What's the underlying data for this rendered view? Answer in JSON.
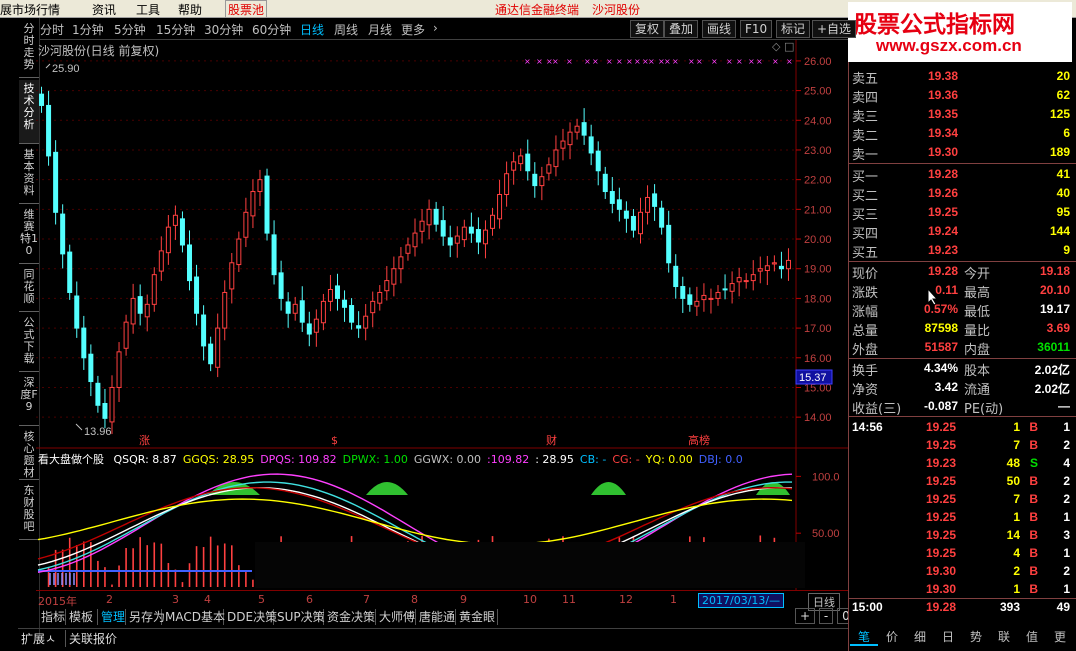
{
  "menu": {
    "items": [
      "展市场行情",
      "资讯",
      "工具",
      "帮助",
      "股票池"
    ],
    "center_text": "通达信金融终端",
    "stock_name": "沙河股份"
  },
  "watermark": {
    "title": "股票公式指标网",
    "url": "www.gszx.com.cn"
  },
  "left_nav": [
    "分时走势",
    "技术分析",
    "基本资料",
    "维赛特10",
    "同花顺",
    "公式下载",
    "深度F9",
    "核心题材",
    "东财股吧"
  ],
  "periods": [
    "分时",
    "1分钟",
    "5分钟",
    "15分钟",
    "30分钟",
    "60分钟",
    "日线",
    "周线",
    "月线",
    "更多"
  ],
  "active_period": "日线",
  "right_buttons": [
    "复权",
    "叠加",
    "画线",
    "F10",
    "标记",
    "+自选"
  ],
  "chart_title": "沙河股份(日线 前复权)",
  "price_chart": {
    "high_label": "25.90",
    "low_label": "13.96",
    "current_price_tag": "15.37",
    "y_ticks": [
      "26.00",
      "25.00",
      "24.00",
      "23.00",
      "22.00",
      "21.00",
      "20.00",
      "19.00",
      "18.00",
      "17.00",
      "16.00",
      "15.00",
      "14.00"
    ],
    "markers": [
      "涨",
      "$",
      "财",
      "高榜"
    ]
  },
  "indicator_bar": {
    "name": "看大盘做个股",
    "items": [
      {
        "label": "QSQR: 8.87",
        "color": "#ffffff"
      },
      {
        "label": "GGQS: 28.95",
        "color": "#ffff00"
      },
      {
        "label": "DPQS: 109.82",
        "color": "#ff40ff"
      },
      {
        "label": "DPWX: 1.00",
        "color": "#00e000"
      },
      {
        "label": "GGWX: 0.00",
        "color": "#c0c0c0"
      },
      {
        "label": ":109.82",
        "color": "#ff40ff"
      },
      {
        "label": ": 28.95",
        "color": "#ffffff"
      },
      {
        "label": "CB: -",
        "color": "#00bfff"
      },
      {
        "label": "CG: -",
        "color": "#ff4040"
      },
      {
        "label": "YQ: 0.00",
        "color": "#ffff00"
      },
      {
        "label": "DBJ: 0.0",
        "color": "#4060ff"
      }
    ],
    "y_ticks": [
      "100.0",
      "50.00"
    ]
  },
  "time_axis": {
    "labels": [
      "2015年",
      "2",
      "3",
      "4",
      "5",
      "6",
      "7",
      "8",
      "9",
      "10",
      "11",
      "12",
      "1"
    ],
    "cursor_date": "2017/03/13/—",
    "period": "日线"
  },
  "bottom_tabs": [
    "指标",
    "模板",
    "管理",
    "另存为",
    "MACD基本",
    "DDE决策",
    "SUP决策",
    "资金决策",
    "大师傅",
    "唐能通",
    "黄金眼"
  ],
  "status_items": [
    "扩展ㅅ",
    "关联报价"
  ],
  "zoom_buttons": [
    "+",
    "-",
    "0"
  ],
  "order_book": {
    "asks": [
      {
        "label": "卖五",
        "price": "19.38",
        "vol": "20"
      },
      {
        "label": "卖四",
        "price": "19.36",
        "vol": "62"
      },
      {
        "label": "卖三",
        "price": "19.35",
        "vol": "125"
      },
      {
        "label": "卖二",
        "price": "19.34",
        "vol": "6"
      },
      {
        "label": "卖一",
        "price": "19.30",
        "vol": "189"
      }
    ],
    "bids": [
      {
        "label": "买一",
        "price": "19.28",
        "vol": "41"
      },
      {
        "label": "买二",
        "price": "19.26",
        "vol": "40"
      },
      {
        "label": "买三",
        "price": "19.25",
        "vol": "95"
      },
      {
        "label": "买四",
        "price": "19.24",
        "vol": "144"
      },
      {
        "label": "买五",
        "price": "19.23",
        "vol": "9"
      }
    ]
  },
  "quote": [
    {
      "l1": "现价",
      "v1": "19.28",
      "c1": "red",
      "l2": "今开",
      "v2": "19.18",
      "c2": "red"
    },
    {
      "l1": "涨跌",
      "v1": "0.11",
      "c1": "red",
      "l2": "最高",
      "v2": "20.10",
      "c2": "red"
    },
    {
      "l1": "涨幅",
      "v1": "0.57%",
      "c1": "red",
      "l2": "最低",
      "v2": "19.17",
      "c2": "white"
    },
    {
      "l1": "总量",
      "v1": "87598",
      "c1": "yellow",
      "l2": "量比",
      "v2": "3.69",
      "c2": "red"
    },
    {
      "l1": "外盘",
      "v1": "51587",
      "c1": "red",
      "l2": "内盘",
      "v2": "36011",
      "c2": "green"
    }
  ],
  "fundamentals": [
    {
      "l1": "换手",
      "v1": "4.34%",
      "l2": "股本",
      "v2": "2.02亿"
    },
    {
      "l1": "净资",
      "v1": "3.42",
      "l2": "流通",
      "v2": "2.02亿"
    },
    {
      "l1": "收益(三)",
      "v1": "-0.087",
      "l2": "PE(动)",
      "v2": "—"
    }
  ],
  "trades": [
    {
      "time": "14:56",
      "price": "19.25",
      "vol": "1",
      "bs": "B",
      "n": "1"
    },
    {
      "time": "",
      "price": "19.25",
      "vol": "7",
      "bs": "B",
      "n": "2"
    },
    {
      "time": "",
      "price": "19.23",
      "vol": "48",
      "bs": "S",
      "n": "4"
    },
    {
      "time": "",
      "price": "19.25",
      "vol": "50",
      "bs": "B",
      "n": "2"
    },
    {
      "time": "",
      "price": "19.25",
      "vol": "7",
      "bs": "B",
      "n": "2"
    },
    {
      "time": "",
      "price": "19.25",
      "vol": "1",
      "bs": "B",
      "n": "1"
    },
    {
      "time": "",
      "price": "19.25",
      "vol": "14",
      "bs": "B",
      "n": "3"
    },
    {
      "time": "",
      "price": "19.25",
      "vol": "4",
      "bs": "B",
      "n": "1"
    },
    {
      "time": "",
      "price": "19.30",
      "vol": "2",
      "bs": "B",
      "n": "2"
    },
    {
      "time": "",
      "price": "19.30",
      "vol": "1",
      "bs": "B",
      "n": "1"
    },
    {
      "time": "15:00",
      "price": "19.28",
      "vol": "393",
      "bs": "",
      "n": "49"
    }
  ],
  "right_tabs": [
    "笔",
    "价",
    "细",
    "日",
    "势",
    "联",
    "值",
    "更"
  ],
  "chart_data": {
    "type": "candlestick",
    "title": "沙河股份(日线 前复权)",
    "ylim": [
      13.5,
      26.3
    ],
    "x_month_labels": [
      "2015年",
      "2",
      "3",
      "4",
      "5",
      "6",
      "7",
      "8",
      "9",
      "10",
      "11",
      "12",
      "1"
    ],
    "series_close_approx": [
      24.5,
      22.8,
      20.9,
      19.5,
      18.2,
      17.0,
      16.0,
      15.2,
      14.4,
      13.96,
      15.0,
      16.2,
      17.2,
      18.0,
      17.5,
      17.8,
      18.8,
      19.6,
      20.4,
      20.8,
      19.8,
      18.6,
      17.5,
      16.4,
      15.8,
      17.0,
      18.2,
      19.2,
      20.0,
      20.9,
      21.6,
      22.0,
      20.2,
      18.8,
      18.0,
      17.5,
      17.8,
      17.2,
      16.8,
      17.3,
      17.9,
      18.3,
      18.0,
      17.7,
      17.2,
      17.0,
      17.4,
      17.9,
      18.2,
      18.6,
      19.0,
      19.4,
      19.8,
      20.2,
      20.6,
      21.0,
      20.5,
      20.1,
      19.8,
      20.1,
      20.4,
      20.2,
      19.9,
      20.3,
      20.8,
      21.5,
      22.2,
      22.6,
      22.8,
      22.3,
      21.8,
      22.1,
      22.5,
      23.0,
      23.3,
      23.6,
      23.8,
      23.5,
      22.9,
      22.3,
      21.6,
      21.2,
      21.0,
      20.7,
      20.3,
      20.9,
      21.4,
      21.1,
      20.4,
      19.2,
      18.4,
      18.0,
      17.8,
      17.9,
      18.1,
      18.0,
      18.2,
      18.3,
      18.5,
      18.7,
      18.6,
      18.8,
      19.0,
      19.1,
      19.2,
      19.0,
      19.28
    ],
    "indicator": {
      "name": "看大盘做个股",
      "QSQR": 8.87,
      "GGQS": 28.95,
      "DPQS": 109.82,
      "DPWX": 1.0,
      "GGWX": 0.0,
      "YQ": 0.0,
      "y_ticks": [
        100.0,
        50.0
      ]
    }
  }
}
